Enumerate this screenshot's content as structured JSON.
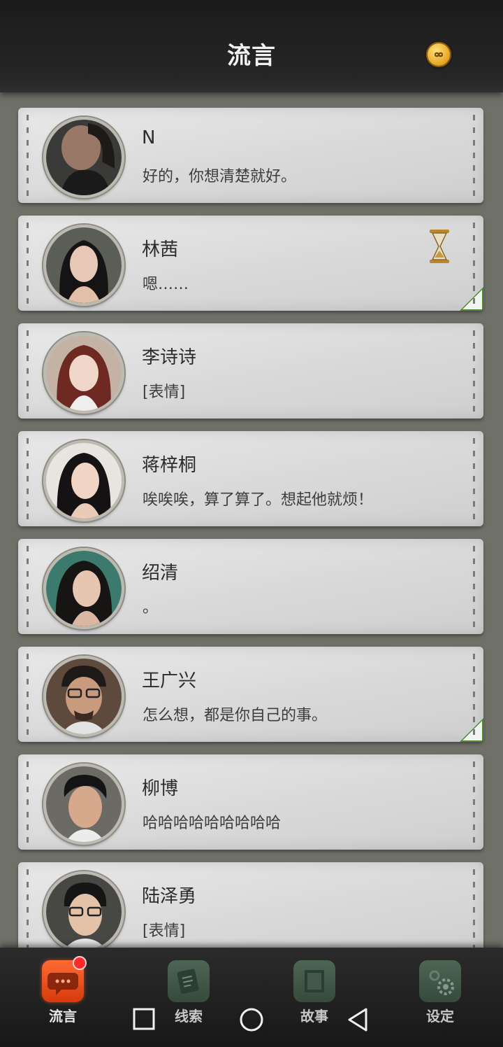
{
  "header": {
    "title": "流言",
    "coin_icon": "infinity-coin-icon"
  },
  "conversations": [
    {
      "name": "N",
      "message": "好的，你想清楚就好。",
      "pending": false,
      "folded": false
    },
    {
      "name": "林茜",
      "message": "嗯……",
      "pending": true,
      "folded": true
    },
    {
      "name": "李诗诗",
      "message": "[表情]",
      "pending": false,
      "folded": false
    },
    {
      "name": "蒋梓桐",
      "message": "唉唉唉，算了算了。想起他就烦！",
      "pending": false,
      "folded": false
    },
    {
      "name": "绍清",
      "message": "。",
      "pending": false,
      "folded": false
    },
    {
      "name": "王广兴",
      "message": "怎么想，都是你自己的事。",
      "pending": false,
      "folded": true
    },
    {
      "name": "柳博",
      "message": "哈哈哈哈哈哈哈哈哈",
      "pending": false,
      "folded": false
    },
    {
      "name": "陆泽勇",
      "message": "[表情]",
      "pending": false,
      "folded": false
    }
  ],
  "nav": [
    {
      "label": "流言",
      "active": true,
      "badge": true
    },
    {
      "label": "线索",
      "active": false,
      "badge": false
    },
    {
      "label": "故事",
      "active": false,
      "badge": false
    },
    {
      "label": "设定",
      "active": false,
      "badge": false
    }
  ],
  "colors": {
    "accent": "#e8501a",
    "folded_corner": "#4f8a2b"
  }
}
